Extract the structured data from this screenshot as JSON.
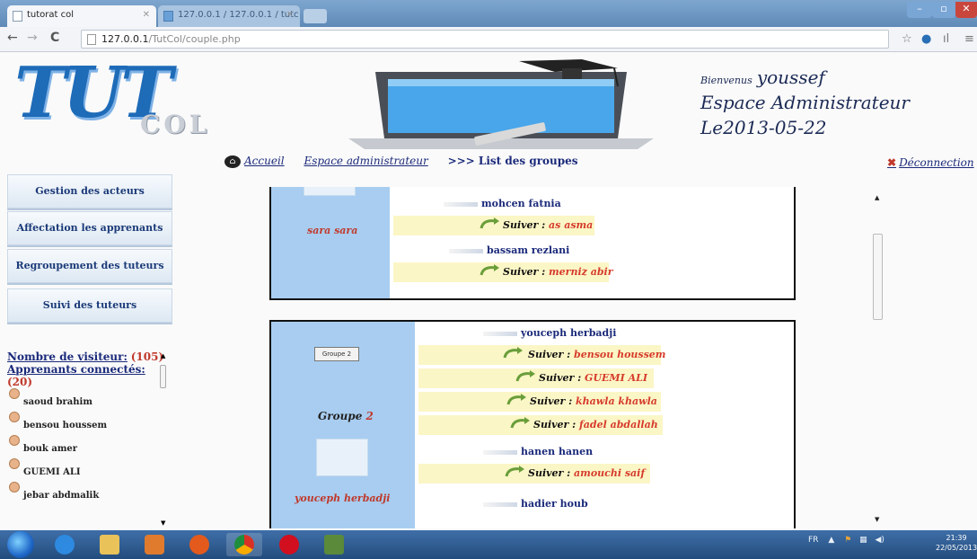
{
  "browser": {
    "tabs": [
      {
        "label": "tutorat col"
      },
      {
        "label": "127.0.0.1 / 127.0.0.1 / tutc"
      }
    ],
    "url_host": "127.0.0.1",
    "url_path": "/TutCol/couple.php"
  },
  "header": {
    "logo_big": "TUT",
    "logo_small": "COL",
    "welcome_label": "Bienvenus",
    "username": "youssef",
    "space_title": "Espace Administrateur",
    "date_text": "Le2013-05-22"
  },
  "nav": {
    "home": "Accueil",
    "admin": "Espace administrateur",
    "current": ">>> List des groupes",
    "logout": "Déconnection"
  },
  "sidebar": {
    "menu": [
      "Gestion des acteurs",
      "Affectation les apprenants",
      "Regroupement des tuteurs",
      "Suivi des tuteurs"
    ],
    "visitors_label": "Nombre de visiteur:",
    "visitors_count": "(105)",
    "connected_label": "Apprenants connectés:",
    "connected_count": "(20)",
    "users": [
      "saoud brahim",
      "bensou houssem",
      "bouk amer",
      "GUEMI ALI",
      "jebar abdmalik"
    ]
  },
  "group1": {
    "side_tutor": "sara sara",
    "entries": [
      {
        "tutor": "mohcen fatnia",
        "suiver_label": "Suiver :",
        "learner": "as asma"
      },
      {
        "tutor": "bassam rezlani",
        "suiver_label": "Suiver :",
        "learner": "merniz abir"
      }
    ]
  },
  "group2": {
    "button_label": "Groupe 2",
    "group_label": "Groupe",
    "group_number": "2",
    "side_tutor": "youceph herbadji",
    "tutor1": "youceph herbadji",
    "learners1": [
      "bensou houssem",
      "GUEMI ALI",
      "khawla khawla",
      "fadel abdallah"
    ],
    "tutor2": "hanen hanen",
    "learners2": [
      "amouchi saif"
    ],
    "tutor3": "hadier houb",
    "suiver_label": "Suiver :"
  },
  "taskbar": {
    "lang": "FR",
    "time": "21:39",
    "date": "22/05/2013"
  },
  "colors": {
    "accent": "#1b2a7a",
    "learner_red": "#d63b2b",
    "group_panel": "#a8cdf0",
    "highlight": "#fbf6c6"
  }
}
